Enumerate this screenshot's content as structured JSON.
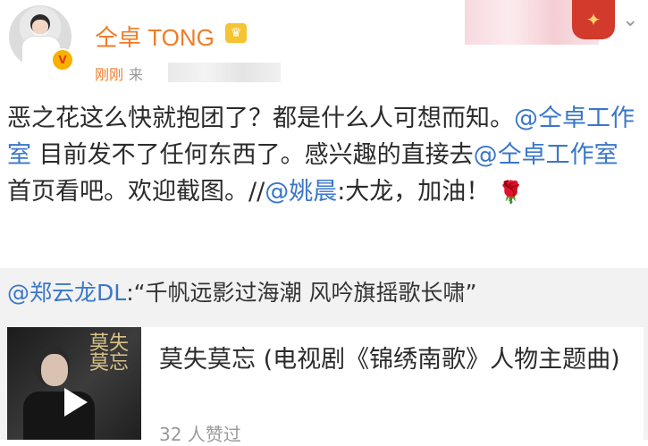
{
  "header": {
    "username": "仝卓 TONG",
    "verified_badge": "V",
    "crown_glyph": "♛",
    "time": "刚刚",
    "source_prefix": "来"
  },
  "post": {
    "seg1": "恶之花这么快就抱团了？都是什么人可想而知。",
    "mention1": "@仝卓工作室",
    "seg2": " 目前发不了任何东西了。感兴趣的直接去",
    "mention2": "@仝卓工作室",
    "seg3": " 首页看吧。欢迎截图。//",
    "mention3": "@姚晨",
    "seg4": ":大龙，加油！",
    "emoji": "🌹"
  },
  "repost": {
    "mention": "@郑云龙DL",
    "quote": ":“千帆远影过海潮  风吟旗摇歌长啸”"
  },
  "media_card": {
    "thumbnail_text": "莫失莫忘",
    "title": "莫失莫忘 (电视剧《锦绣南歌》人物主题曲)",
    "likes": "32 人赞过"
  },
  "icons": [
    "avatar",
    "verified-badge-icon",
    "crown-icon",
    "chevron-down-icon",
    "rose-icon",
    "play-icon"
  ],
  "colors": {
    "username": "#f07c26",
    "link": "#3a77c8",
    "repost_bg": "#f2f2f2"
  }
}
